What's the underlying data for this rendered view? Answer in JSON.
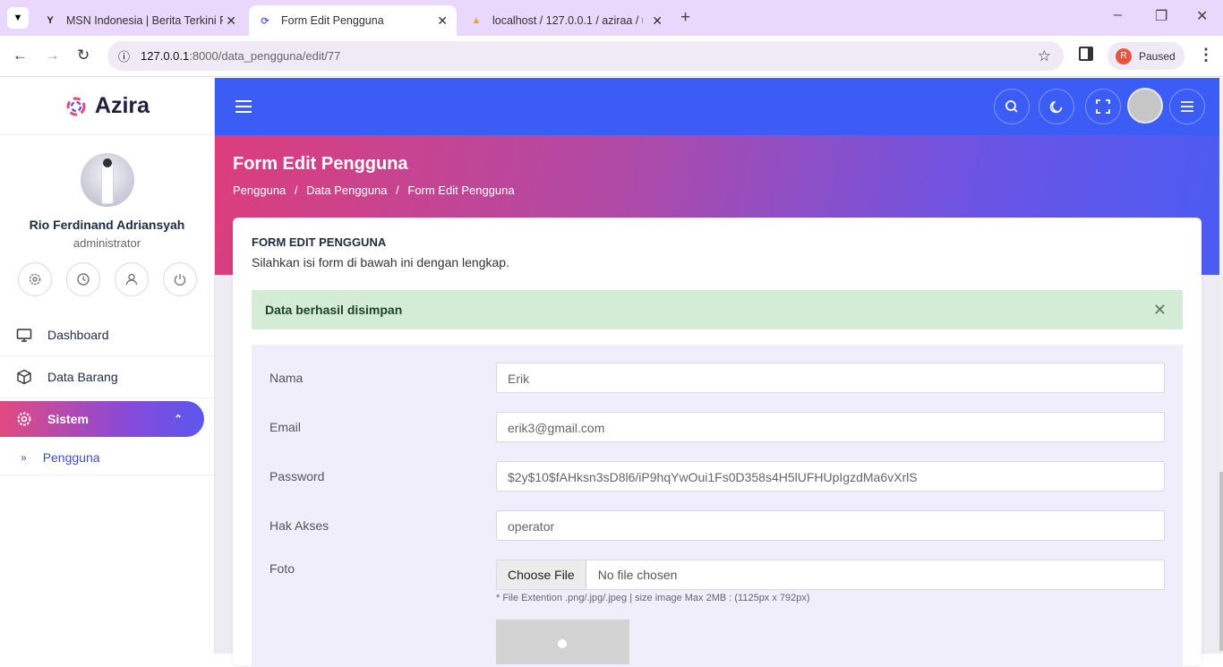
{
  "browser": {
    "tabs": [
      {
        "title": "MSN Indonesia | Berita Terkini F",
        "icon": "msn-icon"
      },
      {
        "title": "Form Edit Pengguna",
        "icon": "azira-icon"
      },
      {
        "title": "localhost / 127.0.0.1 / aziraa / u",
        "icon": "phpmyadmin-icon"
      }
    ],
    "url_host": "127.0.0.1",
    "url_path": ":8000/data_pengguna/edit/77",
    "profile_initial": "R",
    "profile_status": "Paused"
  },
  "sidebar": {
    "brand": "Azira",
    "user_name": "Rio Ferdinand Adriansyah",
    "user_role": "administrator",
    "menu": {
      "dashboard": "Dashboard",
      "data_barang": "Data Barang",
      "sistem": "Sistem",
      "pengguna": "Pengguna"
    }
  },
  "header": {
    "title": "Form Edit Pengguna",
    "breadcrumb": [
      "Pengguna",
      "/",
      "Data Pengguna",
      "/",
      "Form Edit Pengguna"
    ]
  },
  "card": {
    "title": "FORM EDIT PENGGUNA",
    "subtitle": "Silahkan isi form di bawah ini dengan lengkap.",
    "alert": "Data berhasil disimpan",
    "fields": {
      "nama_label": "Nama",
      "nama_value": "Erik",
      "email_label": "Email",
      "email_value": "erik3@gmail.com",
      "password_label": "Password",
      "password_value": "$2y$10$fAHksn3sD8l6/iP9hqYwOui1Fs0D358s4H5lUFHUpIgzdMa6vXrlS",
      "hak_label": "Hak Akses",
      "hak_value": "operator",
      "foto_label": "Foto",
      "file_button": "Choose File",
      "file_status": "No file chosen",
      "file_hint": "* File Extention .png/.jpg/.jpeg | size image Max 2MB : (1125px x 792px)"
    }
  },
  "colors": {
    "topbar": "#3c5cf6",
    "accent_pink": "#dc3e7c",
    "alert_bg": "#d4ecd5"
  }
}
